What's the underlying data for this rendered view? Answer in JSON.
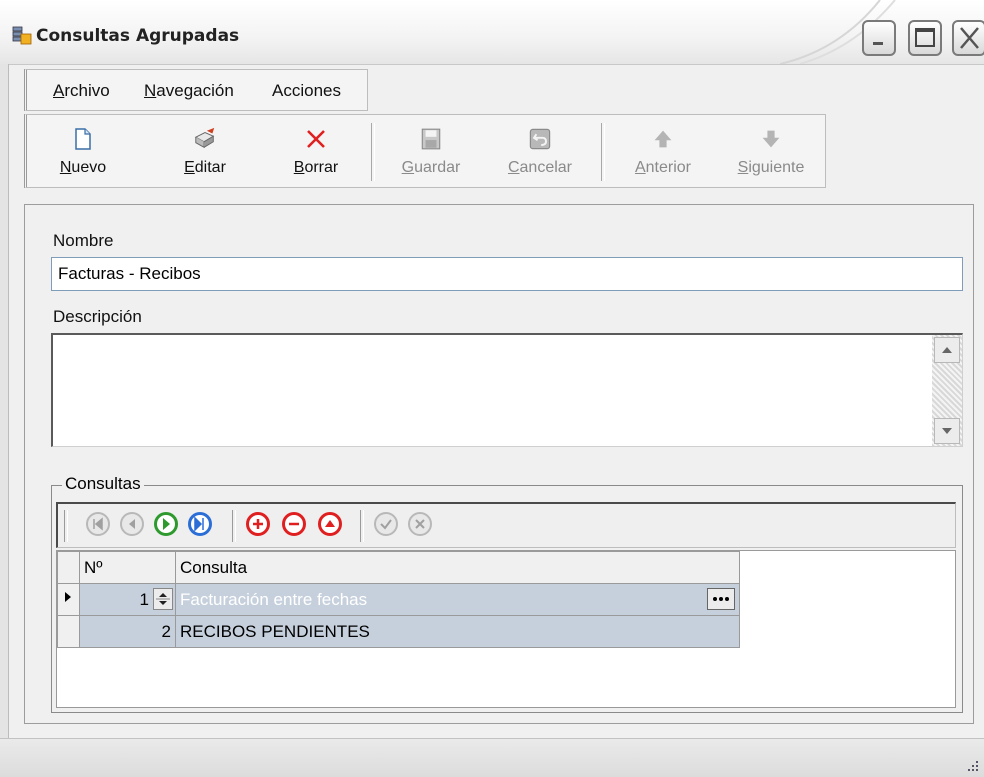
{
  "window": {
    "title": "Consultas Agrupadas"
  },
  "menu": {
    "items": [
      {
        "label": "Archivo"
      },
      {
        "label": "Navegación"
      },
      {
        "label": "Acciones"
      }
    ]
  },
  "toolbar": {
    "buttons": [
      {
        "label": "Nuevo",
        "icon": "new-document-icon",
        "enabled": true
      },
      {
        "label": "Editar",
        "icon": "edit-icon",
        "enabled": true
      },
      {
        "label": "Borrar",
        "icon": "delete-x-icon",
        "enabled": true
      },
      {
        "label": "Guardar",
        "icon": "save-disk-icon",
        "enabled": false
      },
      {
        "label": "Cancelar",
        "icon": "cancel-undo-icon",
        "enabled": false
      },
      {
        "label": "Anterior",
        "icon": "arrow-up-icon",
        "enabled": false
      },
      {
        "label": "Siguiente",
        "icon": "arrow-down-icon",
        "enabled": false
      }
    ]
  },
  "form": {
    "nombre_label": "Nombre",
    "nombre_value": "Facturas - Recibos",
    "descripcion_label": "Descripción",
    "descripcion_value": ""
  },
  "consultas": {
    "group_title": "Consultas",
    "columns": [
      "Nº",
      "Consulta"
    ],
    "rows": [
      {
        "num": "1",
        "consulta": "Facturación entre fechas",
        "selected": true
      },
      {
        "num": "2",
        "consulta": "RECIBOS PENDIENTES",
        "selected": false
      }
    ],
    "nav_buttons": [
      "first-record-icon",
      "prior-record-icon",
      "next-record-icon",
      "last-record-icon",
      "insert-record-icon",
      "delete-record-icon",
      "edit-record-icon",
      "post-record-icon",
      "cancel-record-icon"
    ]
  },
  "colors": {
    "selected_row": "#c6d0dc",
    "selected_text": "#ffffff",
    "nav_green": "#2e9a2e",
    "nav_blue": "#2b6fd6",
    "nav_red": "#e02020"
  }
}
